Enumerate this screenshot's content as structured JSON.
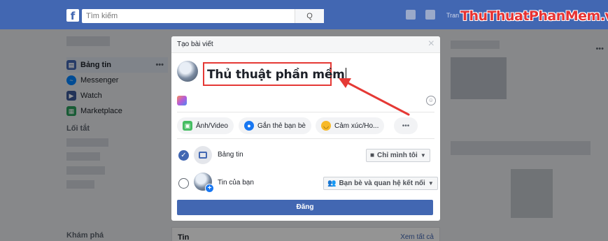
{
  "topbar": {
    "logo": "f",
    "search_placeholder": "Tìm kiếm",
    "search_button": "Q",
    "user_name": "Tran"
  },
  "watermark": "ThuThuatPhanMem.vn",
  "sidebar": {
    "items": [
      {
        "label": "Bảng tin",
        "icon": "news-feed-icon",
        "active": true
      },
      {
        "label": "Messenger",
        "icon": "messenger-icon"
      },
      {
        "label": "Watch",
        "icon": "watch-icon"
      },
      {
        "label": "Marketplace",
        "icon": "marketplace-icon"
      }
    ],
    "more": "•••",
    "shortcuts_heading": "Lối tắt",
    "explore_heading": "Khám phá"
  },
  "rightcol": {
    "more": "•••"
  },
  "modal": {
    "title": "Tạo bài viết",
    "close": "×",
    "composer_text": "Thủ thuật phần mềm",
    "actions": [
      {
        "label": "Ảnh/Video",
        "icon": "photo-icon"
      },
      {
        "label": "Gắn thẻ bạn bè",
        "icon": "tag-friends-icon"
      },
      {
        "label": "Cảm xúc/Ho...",
        "icon": "feeling-icon"
      },
      {
        "label": "•••",
        "icon": "more-icon"
      }
    ],
    "destinations": [
      {
        "label": "Bảng tin",
        "audience": "Chỉ mình tôi",
        "selected": true
      },
      {
        "label": "Tin của bạn",
        "audience": "Bạn bè và quan hệ kết nối",
        "selected": false
      }
    ],
    "post_button": "Đăng"
  },
  "bottomcard": {
    "title": "Tin",
    "link": "Xem tất cả"
  },
  "colors": {
    "brand": "#4267b2",
    "highlight": "#e53935"
  }
}
